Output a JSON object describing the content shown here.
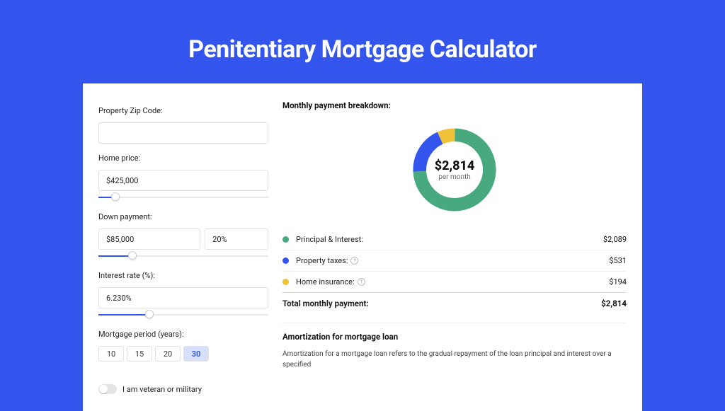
{
  "title": "Penitentiary Mortgage Calculator",
  "form": {
    "zip_label": "Property Zip Code:",
    "zip_value": "",
    "price_label": "Home price:",
    "price_value": "$425,000",
    "price_slider_pct": 10,
    "down_label": "Down payment:",
    "down_value": "$85,000",
    "down_pct": "20%",
    "down_slider_pct": 20,
    "rate_label": "Interest rate (%):",
    "rate_value": "6.230%",
    "rate_slider_pct": 30,
    "period_label": "Mortgage period (years):",
    "periods": [
      "10",
      "15",
      "20",
      "30"
    ],
    "period_active": "30",
    "veteran_label": "I am veteran or military"
  },
  "breakdown": {
    "title": "Monthly payment breakdown:",
    "center_amount": "$2,814",
    "center_sub": "per month",
    "items": [
      {
        "label": "Principal & Interest:",
        "value": "$2,089",
        "color": "#49a97e",
        "info": false
      },
      {
        "label": "Property taxes:",
        "value": "$531",
        "color": "#3355ee",
        "info": true
      },
      {
        "label": "Home insurance:",
        "value": "$194",
        "color": "#efc23a",
        "info": true
      }
    ],
    "total_label": "Total monthly payment:",
    "total_value": "$2,814"
  },
  "amort": {
    "title": "Amortization for mortgage loan",
    "text": "Amortization for a mortgage loan refers to the gradual repayment of the loan principal and interest over a specified"
  },
  "chart_data": {
    "type": "pie",
    "title": "Monthly payment breakdown",
    "series": [
      {
        "name": "Principal & Interest",
        "value": 2089,
        "color": "#49a97e"
      },
      {
        "name": "Property taxes",
        "value": 531,
        "color": "#3355ee"
      },
      {
        "name": "Home insurance",
        "value": 194,
        "color": "#efc23a"
      }
    ],
    "total": 2814
  }
}
